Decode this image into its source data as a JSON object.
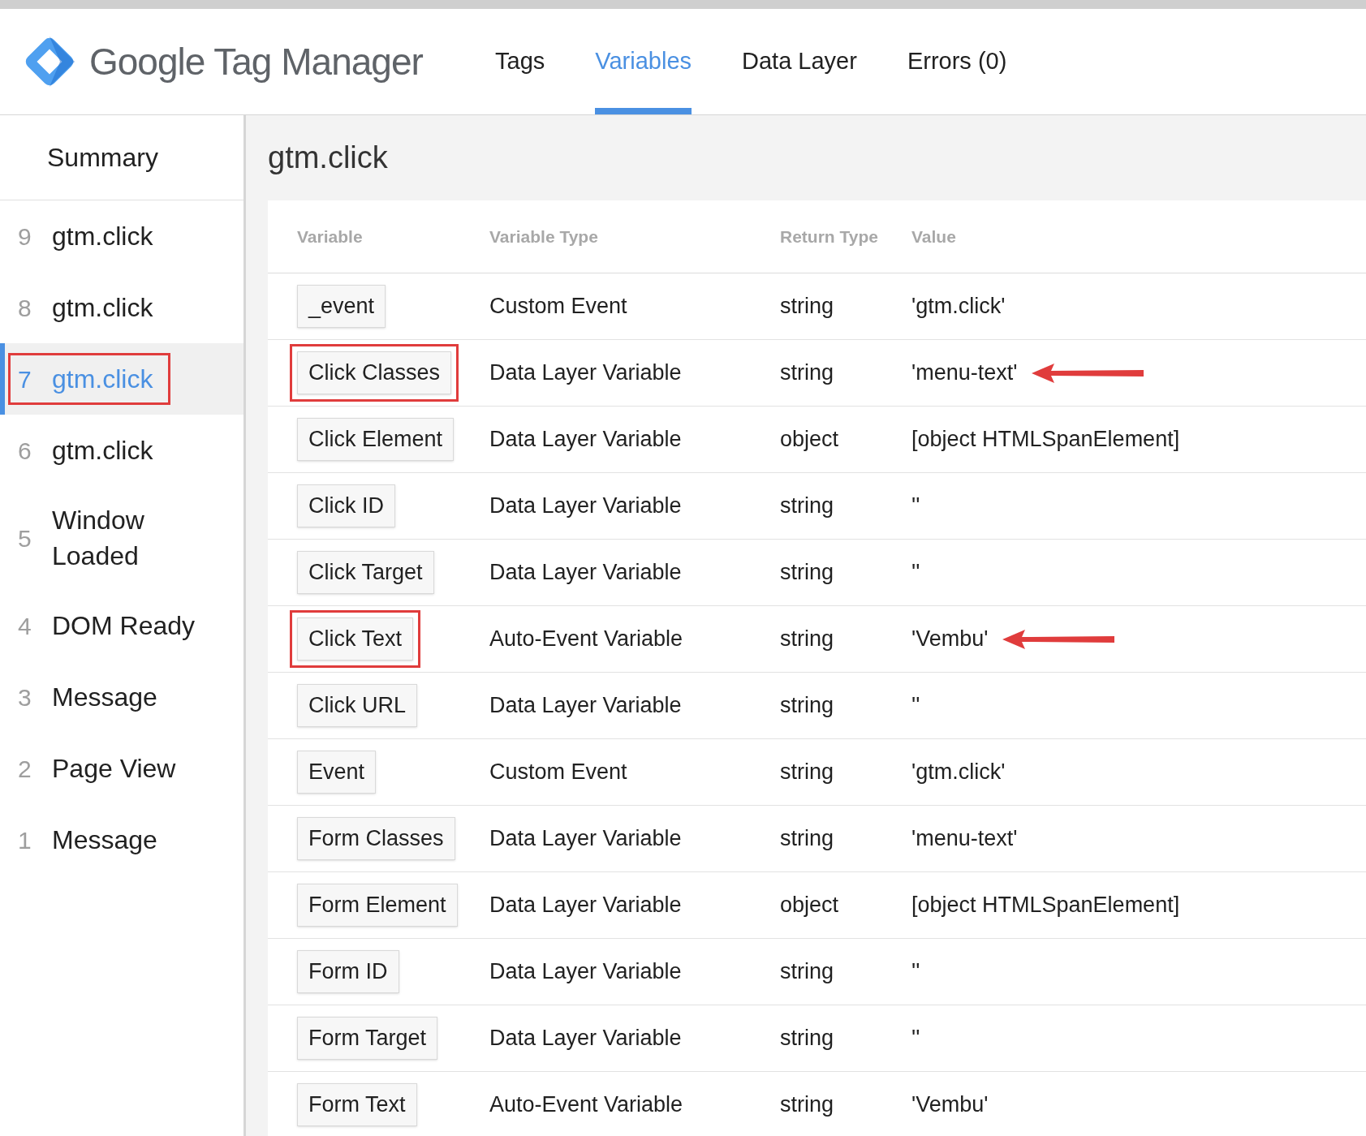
{
  "header": {
    "product": "Google Tag Manager",
    "tabs": [
      {
        "label": "Tags",
        "selected": false
      },
      {
        "label": "Variables",
        "selected": true
      },
      {
        "label": "Data Layer",
        "selected": false
      },
      {
        "label": "Errors (0)",
        "selected": false
      }
    ]
  },
  "sidebar": {
    "summary": "Summary",
    "items": [
      {
        "number": "9",
        "label": "gtm.click",
        "selected": false,
        "highlighted": false
      },
      {
        "number": "8",
        "label": "gtm.click",
        "selected": false,
        "highlighted": false
      },
      {
        "number": "7",
        "label": "gtm.click",
        "selected": true,
        "highlighted": true
      },
      {
        "number": "6",
        "label": "gtm.click",
        "selected": false,
        "highlighted": false
      },
      {
        "number": "5",
        "label": "Window Loaded",
        "selected": false,
        "highlighted": false
      },
      {
        "number": "4",
        "label": "DOM Ready",
        "selected": false,
        "highlighted": false
      },
      {
        "number": "3",
        "label": "Message",
        "selected": false,
        "highlighted": false
      },
      {
        "number": "2",
        "label": "Page View",
        "selected": false,
        "highlighted": false
      },
      {
        "number": "1",
        "label": "Message",
        "selected": false,
        "highlighted": false
      }
    ]
  },
  "main": {
    "title": "gtm.click",
    "table": {
      "columns": [
        "Variable",
        "Variable Type",
        "Return Type",
        "Value"
      ],
      "rows": [
        {
          "variable": "_event",
          "type": "Custom Event",
          "return_type": "string",
          "value": "'gtm.click'",
          "highlighted": false,
          "arrow": false
        },
        {
          "variable": "Click Classes",
          "type": "Data Layer Variable",
          "return_type": "string",
          "value": "'menu-text'",
          "highlighted": true,
          "arrow": true
        },
        {
          "variable": "Click Element",
          "type": "Data Layer Variable",
          "return_type": "object",
          "value": "[object HTMLSpanElement]",
          "highlighted": false,
          "arrow": false
        },
        {
          "variable": "Click ID",
          "type": "Data Layer Variable",
          "return_type": "string",
          "value": "''",
          "highlighted": false,
          "arrow": false
        },
        {
          "variable": "Click Target",
          "type": "Data Layer Variable",
          "return_type": "string",
          "value": "''",
          "highlighted": false,
          "arrow": false
        },
        {
          "variable": "Click Text",
          "type": "Auto-Event Variable",
          "return_type": "string",
          "value": "'Vembu'",
          "highlighted": true,
          "arrow": true
        },
        {
          "variable": "Click URL",
          "type": "Data Layer Variable",
          "return_type": "string",
          "value": "''",
          "highlighted": false,
          "arrow": false
        },
        {
          "variable": "Event",
          "type": "Custom Event",
          "return_type": "string",
          "value": "'gtm.click'",
          "highlighted": false,
          "arrow": false
        },
        {
          "variable": "Form Classes",
          "type": "Data Layer Variable",
          "return_type": "string",
          "value": "'menu-text'",
          "highlighted": false,
          "arrow": false
        },
        {
          "variable": "Form Element",
          "type": "Data Layer Variable",
          "return_type": "object",
          "value": "[object HTMLSpanElement]",
          "highlighted": false,
          "arrow": false
        },
        {
          "variable": "Form ID",
          "type": "Data Layer Variable",
          "return_type": "string",
          "value": "''",
          "highlighted": false,
          "arrow": false
        },
        {
          "variable": "Form Target",
          "type": "Data Layer Variable",
          "return_type": "string",
          "value": "''",
          "highlighted": false,
          "arrow": false
        },
        {
          "variable": "Form Text",
          "type": "Auto-Event Variable",
          "return_type": "string",
          "value": "'Vembu'",
          "highlighted": false,
          "arrow": false
        }
      ]
    }
  }
}
